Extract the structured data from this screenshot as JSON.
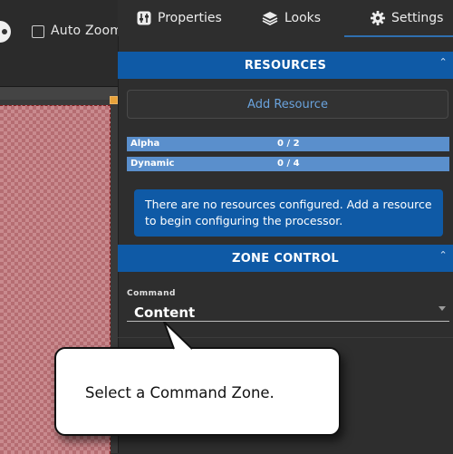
{
  "toolbar": {
    "auto_zoom_label": "Auto Zoom",
    "auto_zoom_checked": false
  },
  "tabs": [
    {
      "label": "Properties",
      "icon": "sliders-icon",
      "active": false
    },
    {
      "label": "Looks",
      "icon": "layers-icon",
      "active": false
    },
    {
      "label": "Settings",
      "icon": "gear-icon",
      "active": true
    }
  ],
  "resources": {
    "header": "RESOURCES",
    "add_button": "Add Resource",
    "rows": [
      {
        "name": "Alpha",
        "value": "0 / 2"
      },
      {
        "name": "Dynamic",
        "value": "0 / 4"
      }
    ],
    "info": "There are no resources configured. Add a resource to begin configuring the processor."
  },
  "zone_control": {
    "header": "ZONE CONTROL",
    "command_label": "Command",
    "command_value": "Content"
  },
  "callout": {
    "text": "Select a Command Zone."
  },
  "colors": {
    "panel_bg": "#2e2e2e",
    "section_header": "#0f5aa6",
    "resource_row": "#5a8fcc",
    "accent_link": "#6aa3dd",
    "canvas_checker": "#c98a8e"
  }
}
